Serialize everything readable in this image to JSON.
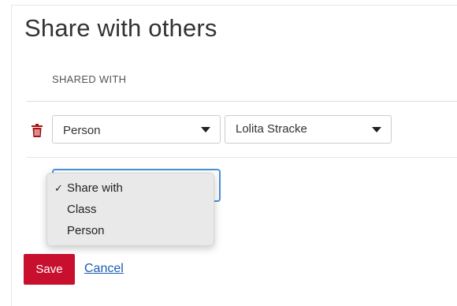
{
  "page": {
    "title": "Share with others",
    "section_label": "SHARED WITH"
  },
  "share_row": {
    "type_value": "Person",
    "person_value": "Lolita Stracke"
  },
  "new_share": {
    "options": [
      {
        "label": "Share with",
        "checked": true,
        "check_glyph": "✓"
      },
      {
        "label": "Class",
        "checked": false
      },
      {
        "label": "Person",
        "checked": false
      }
    ]
  },
  "actions": {
    "save_label": "Save",
    "cancel_label": "Cancel"
  },
  "colors": {
    "primary": "#c8102e",
    "link": "#1a5bb8",
    "focus": "#4a90d9",
    "trash": "#a81515"
  },
  "icons": {
    "delete": "trash-icon",
    "dropdown": "caret-down-icon"
  }
}
